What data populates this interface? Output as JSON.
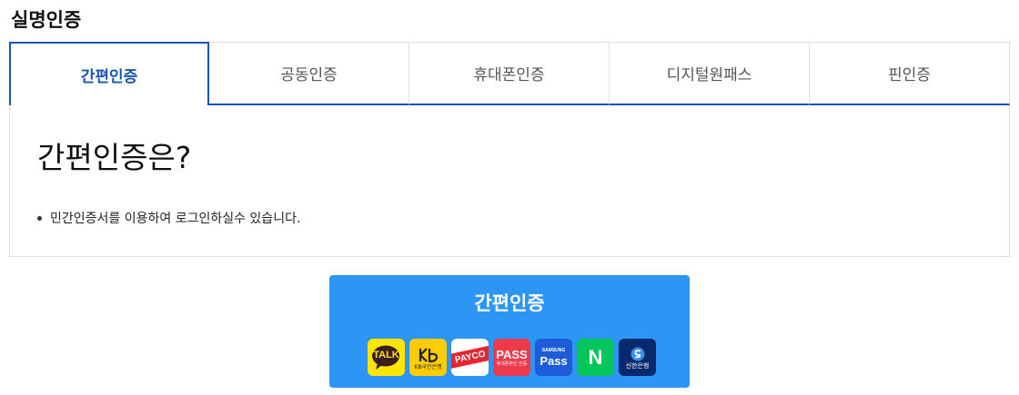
{
  "page": {
    "title": "실명인증"
  },
  "tabs": [
    {
      "label": "간편인증",
      "active": true
    },
    {
      "label": "공동인증",
      "active": false
    },
    {
      "label": "휴대폰인증",
      "active": false
    },
    {
      "label": "디지털원패스",
      "active": false
    },
    {
      "label": "핀인증",
      "active": false
    }
  ],
  "panel": {
    "heading": "간편인증은?",
    "bullet": "민간인증서를 이용하여 로그인하실수 있습니다."
  },
  "auth_button": {
    "label": "간편인증"
  },
  "providers": [
    {
      "icon": "kakaotalk-icon",
      "text": "TALK",
      "bg": "#fee500",
      "fg": "#3a1d1d"
    },
    {
      "icon": "kb-bank-icon",
      "text": "KB국민은행",
      "bg": "#ffcc00",
      "fg": "#222222"
    },
    {
      "icon": "payco-icon",
      "text": "PAYCO",
      "bg": "#ffffff",
      "fg": "#ffffff",
      "accent": "#e6262e"
    },
    {
      "icon": "pass-icon",
      "text": "PASS",
      "sub": "휴대폰본인 인증",
      "bg": "#ee3a4a",
      "fg": "#ffffff"
    },
    {
      "icon": "samsung-pass-icon",
      "text": "Pass",
      "sub": "SAMSUNG",
      "bg": "#1e5bd8",
      "fg": "#ffffff"
    },
    {
      "icon": "naver-icon",
      "text": "N",
      "bg": "#03c75a",
      "fg": "#ffffff"
    },
    {
      "icon": "shinhan-bank-icon",
      "text": "신한은행",
      "bg": "#0a2a6e",
      "fg": "#ffffff"
    }
  ]
}
